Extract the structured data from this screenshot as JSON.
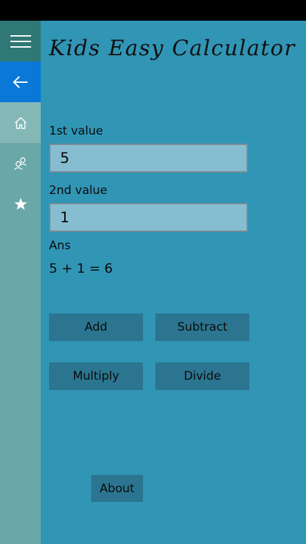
{
  "app": {
    "title": "Kids Easy Calculator"
  },
  "nav": {
    "items": [
      {
        "icon": "hamburger-menu-icon"
      },
      {
        "icon": "back-arrow-icon"
      },
      {
        "icon": "home-icon"
      },
      {
        "icon": "people-icon"
      },
      {
        "icon": "star-icon"
      }
    ]
  },
  "form": {
    "first_label": "1st value",
    "first_value": "5",
    "second_label": "2nd value",
    "second_value": "1",
    "answer_label": "Ans",
    "answer_text": "5 + 1 = 6"
  },
  "buttons": {
    "add": "Add",
    "subtract": "Subtract",
    "multiply": "Multiply",
    "divide": "Divide",
    "about": "About"
  },
  "colors": {
    "background": "#3195b5",
    "sidebar": "#6aa8a8",
    "hamburger_bg": "#2f7876",
    "back_bg": "#0a78d7",
    "home_bg": "#84b8b7",
    "field_bg": "#86bdd0",
    "button_bg": "#2b7590"
  }
}
